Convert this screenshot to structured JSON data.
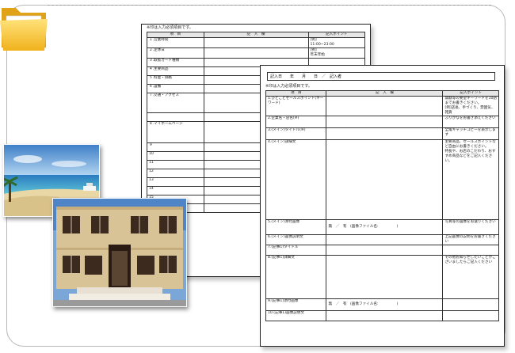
{
  "sheet1": {
    "note": "※印は入力必須項目です。",
    "headers": [
      "項　目",
      "記　入　欄",
      "記入ポイント"
    ],
    "rows": [
      {
        "label": "１.営業時間",
        "point": "[例]\n11:00~23:00"
      },
      {
        "label": "２.定休日",
        "point": "[例]\n年末年始"
      },
      {
        "label": "３.取扱カード種類",
        "point": ""
      },
      {
        "label": "４.主要商品",
        "point": ""
      },
      {
        "label": "５.料金・価格",
        "point": ""
      },
      {
        "label": "６.設備",
        "point": ""
      },
      {
        "label": "７.交通・アクセス",
        "point": ""
      },
      {
        "label": "",
        "point": ""
      },
      {
        "label": "８.マイホームページ",
        "point": ""
      },
      {
        "label": "９",
        "point": ""
      },
      {
        "label": "10",
        "point": ""
      },
      {
        "label": "11",
        "point": ""
      },
      {
        "label": "12",
        "point": ""
      },
      {
        "label": "13",
        "point": ""
      },
      {
        "label": "14",
        "point": ""
      },
      {
        "label": "15",
        "point": ""
      },
      {
        "label": "16",
        "point": ""
      }
    ]
  },
  "sheet2": {
    "header_line": "記入日　　年　　月　　日　／　記入者",
    "note": "※印は入力必須項目です。",
    "headers": [
      "項　目",
      "記　入　欄",
      "記入ポイント"
    ],
    "rows": [
      {
        "label": "1.ひとことセールスポイント(キーワード)",
        "entry": "",
        "point": "無駄等の要望キーワードを10語までお書きください。\n[例]店長、手づくり、雰囲気、雑貨"
      },
      {
        "label": "2.企業名・店名(※)",
        "entry": "",
        "point": "ふりがなをお書き添えください"
      },
      {
        "label": "3.(メイン)タイトル(※)",
        "entry": "",
        "point": "全角キャッチコピーを表示します"
      },
      {
        "label": "4.(メイン)詳細文",
        "entry": "",
        "point": "主要商品、セールスポイントなど自由にお書きください。\n特長や、お店のこだわり、おすすめ商品などをご記入ください。"
      },
      {
        "label": "5.(メイン)添付画像",
        "entry": "無　／　有　(画像ファイル名:　　　　　)",
        "point": "写真等の画像をお送りください"
      },
      {
        "label": "6.(メイン)画像説明文",
        "entry": "",
        "point": "上記画像の説明をお書きください"
      },
      {
        "label": "7.(記事1)タイトル",
        "entry": "",
        "point": ""
      },
      {
        "label": "8.(記事1)詳細文",
        "entry": "",
        "point": "その他お知らせしたいことがございましたらご記入ください"
      },
      {
        "label": "9.(記事1)添付画像",
        "entry": "無　／　有　(画像ファイル名:　　　　　)",
        "point": ""
      },
      {
        "label": "10.(記事1)画像説明文",
        "entry": "",
        "point": ""
      }
    ]
  },
  "colors": {
    "folder": "#f5c63f",
    "folder_dark": "#e0a318",
    "frame": "#b8b8b8"
  }
}
